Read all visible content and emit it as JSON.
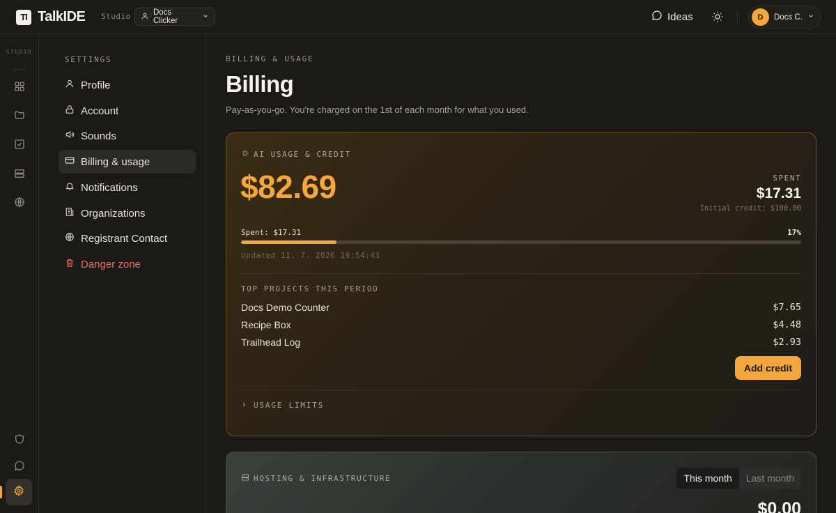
{
  "topbar": {
    "logo_mark": "TI",
    "app_name": "TalkIDE",
    "studio_tag": "Studio",
    "project": "Docs Clicker",
    "ideas_label": "Ideas",
    "user_initial": "D",
    "user_name": "Docs C."
  },
  "rail": {
    "label": "STUDIO",
    "icons": [
      "grid-icon",
      "folder-icon",
      "checkbox-icon",
      "server-icon",
      "globe-icon",
      "shield-icon",
      "chat-icon",
      "gear-icon"
    ]
  },
  "settings_nav": {
    "title": "SETTINGS",
    "items": [
      {
        "label": "Profile",
        "icon": "user-icon"
      },
      {
        "label": "Account",
        "icon": "lock-icon"
      },
      {
        "label": "Sounds",
        "icon": "speaker-icon"
      },
      {
        "label": "Billing & usage",
        "icon": "card-icon",
        "active": true
      },
      {
        "label": "Notifications",
        "icon": "bell-icon"
      },
      {
        "label": "Organizations",
        "icon": "building-icon"
      },
      {
        "label": "Registrant Contact",
        "icon": "globe-icon"
      },
      {
        "label": "Danger zone",
        "icon": "trash-icon",
        "danger": true
      }
    ]
  },
  "main": {
    "eyebrow": "BILLING & USAGE",
    "title": "Billing",
    "description": "Pay-as-you-go. You're charged on the 1st of each month for what you used."
  },
  "credit_card": {
    "heading": "AI USAGE & CREDIT",
    "balance": "$82.69",
    "spent_label": "SPENT",
    "spent_amount": "$17.31",
    "initial_credit": "Initial credit: $100.00",
    "bar_label": "Spent: $17.31",
    "bar_pct_text": "17%",
    "bar_fraction": 0.17,
    "updated": "Updated 11. 7. 2026 19:54:43",
    "top_projects_title": "TOP PROJECTS THIS PERIOD",
    "projects": [
      {
        "name": "Docs Demo Counter",
        "amount": "$7.65"
      },
      {
        "name": "Recipe Box",
        "amount": "$4.48"
      },
      {
        "name": "Trailhead Log",
        "amount": "$2.93"
      }
    ],
    "add_credit_label": "Add credit",
    "usage_limits_label": "USAGE LIMITS"
  },
  "hosting_card": {
    "heading": "HOSTING & INFRASTRUCTURE",
    "periods": [
      "This month",
      "Last month"
    ],
    "selected_period": "This month",
    "amount": "$0.00"
  },
  "colors": {
    "accent": "#f5a73b",
    "background": "#1b1a17",
    "danger": "#f06a5e"
  }
}
